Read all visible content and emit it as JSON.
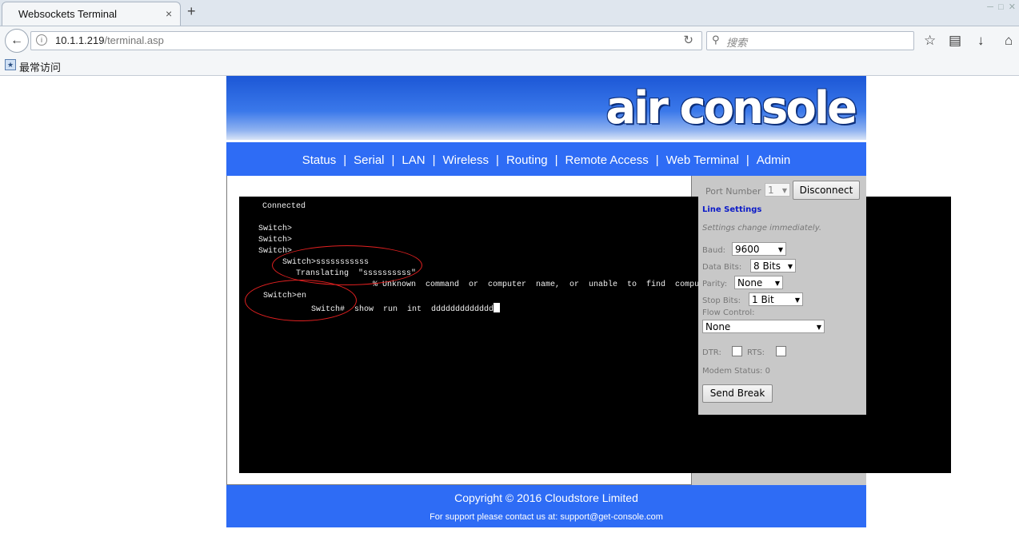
{
  "browser": {
    "tab_title": "Websockets Terminal",
    "tab_close": "×",
    "new_tab": "+",
    "url_host": "10.1.1.219",
    "url_path": "/terminal.asp",
    "search_placeholder": "搜索",
    "bookmark_label": "最常访问"
  },
  "site": {
    "logo": "air console",
    "menu": [
      "Status",
      "Serial",
      "LAN",
      "Wireless",
      "Routing",
      "Remote Access",
      "Web Terminal",
      "Admin"
    ],
    "footer_copyright": "Copyright © 2016 Cloudstore Limited",
    "footer_support": "For support please contact us at: support@get-console.com"
  },
  "terminal": {
    "lines": [
      "Connected",
      "Switch>",
      "Switch>",
      "Switch>",
      "Switch>sssssssssss",
      "Translating  \"ssssssssss\"",
      "% Unknown  command  or  computer  name,  or  unable  to  find  computer",
      "Switch>en",
      "Switch#  show  run  int  ddddddddddddd"
    ]
  },
  "panel": {
    "port_number_label": "Port Number",
    "port_number_value": "1",
    "disconnect_label": "Disconnect",
    "line_settings_title": "Line Settings",
    "settings_note": "Settings change immediately.",
    "baud_label": "Baud:",
    "baud_value": "9600",
    "data_bits_label": "Data Bits:",
    "data_bits_value": "8 Bits",
    "parity_label": "Parity:",
    "parity_value": "None",
    "stop_bits_label": "Stop Bits:",
    "stop_bits_value": "1 Bit",
    "flow_control_label": "Flow Control:",
    "flow_control_value": "None",
    "dtr_label": "DTR:",
    "rts_label": "RTS:",
    "modem_status_label": "Modem Status: 0",
    "send_break_label": "Send Break"
  },
  "colors": {
    "menu_bg": "#2e6cf5",
    "annotation": "#e02020",
    "terminal_bg": "#000000"
  }
}
